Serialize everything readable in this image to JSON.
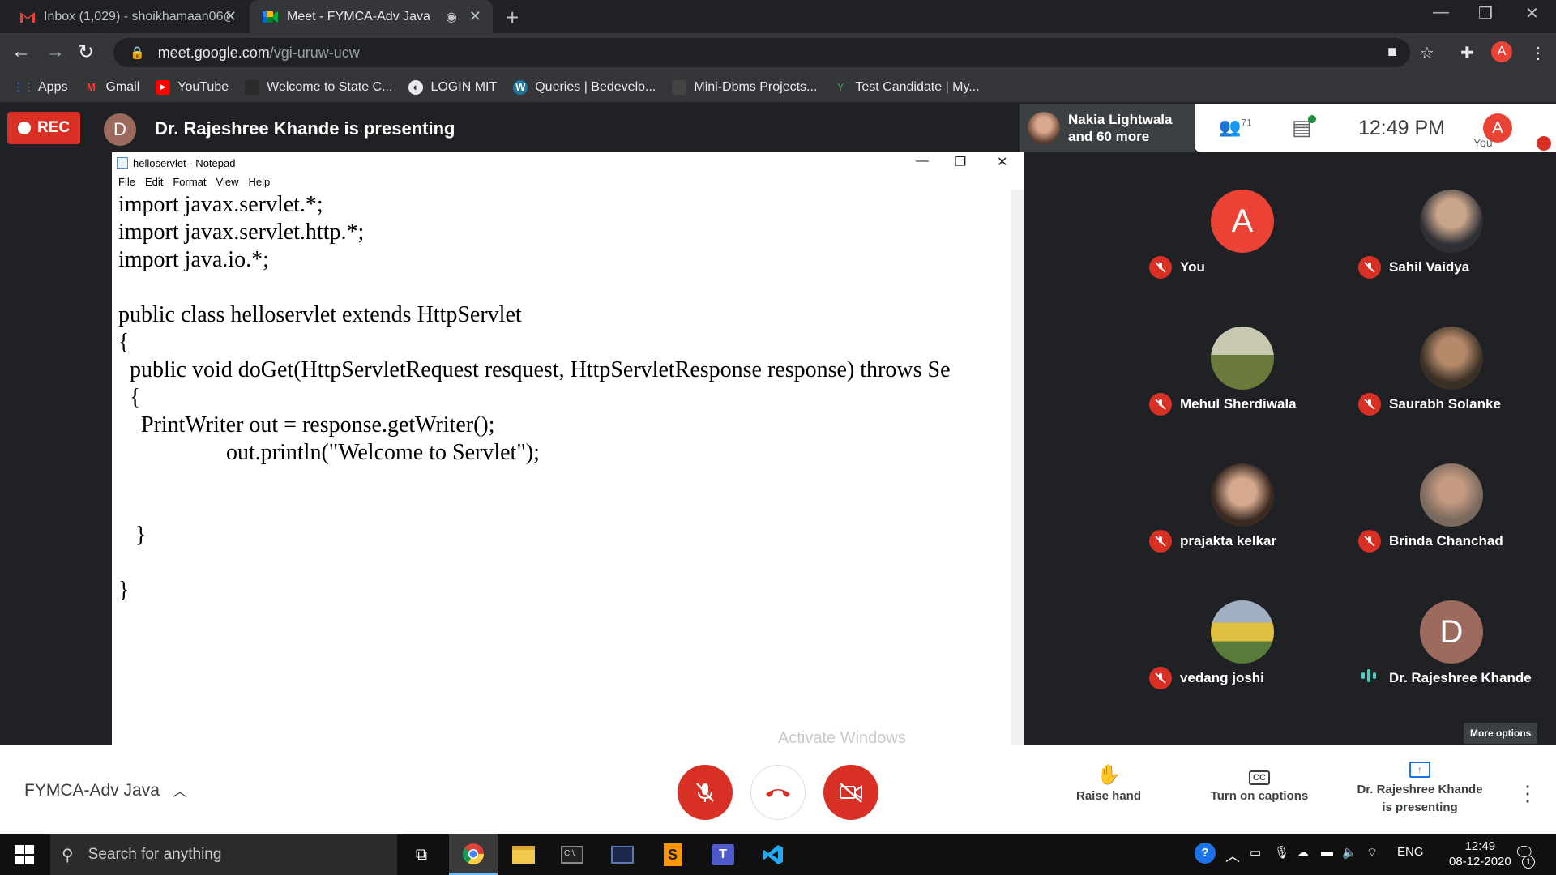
{
  "tabs": [
    {
      "title": "Inbox (1,029) - shoikhamaan06@",
      "favicon": "gmail-icon"
    },
    {
      "title": "Meet - FYMCA-Adv Java",
      "favicon": "meet-icon"
    }
  ],
  "address": {
    "host": "meet.google.com",
    "path": "/vgi-uruw-ucw",
    "profile": "A"
  },
  "bookmarks": [
    "Apps",
    "Gmail",
    "YouTube",
    "Welcome to State C...",
    "LOGIN MIT",
    "Queries | Bedevelo...",
    "Mini-Dbms Projects...",
    "Test Candidate | My..."
  ],
  "meet": {
    "rec_label": "REC",
    "presenter_initial": "D",
    "presenting_title": "Dr. Rajeshree Khande is presenting",
    "featured": {
      "name": "Nakia Lightwala",
      "more": "and 60 more"
    },
    "participant_count": "71",
    "clock": "12:49  PM",
    "you_label": "You",
    "you_initial": "A",
    "meeting_name": "FYMCA-Adv Java",
    "more_options": "More options",
    "controls": {
      "raise_hand": "Raise hand",
      "captions": "Turn on captions",
      "presenting_line1": "Dr. Rajeshree Khande",
      "presenting_line2": "is presenting"
    }
  },
  "notepad": {
    "title": "helloservlet - Notepad",
    "menu": [
      "File",
      "Edit",
      "Format",
      "View",
      "Help"
    ],
    "code": "import javax.servlet.*;\nimport javax.servlet.http.*;\nimport java.io.*;\n\npublic class helloservlet extends HttpServlet\n{\n  public void doGet(HttpServletRequest resquest, HttpServletResponse response) throws Se\n  {\n    PrintWriter out = response.getWriter();\n                   out.println(\"Welcome to Servlet\");\n\n\n   }\n\n}",
    "watermark": "Activate Windows"
  },
  "participants": [
    {
      "name": "You",
      "initial": "A",
      "color": "#ea4335",
      "muted": true
    },
    {
      "name": "Sahil Vaidya",
      "initial": "",
      "color": "#4a4a52",
      "muted": true
    },
    {
      "name": "Mehul Sherdiwala",
      "initial": "",
      "color": "#8a7a4a",
      "muted": true
    },
    {
      "name": "Saurabh Solanke",
      "initial": "",
      "color": "#5a4a3a",
      "muted": true
    },
    {
      "name": "prajakta kelkar",
      "initial": "",
      "color": "#7a5a4a",
      "muted": true
    },
    {
      "name": "Brinda Chanchad",
      "initial": "",
      "color": "#6a5a50",
      "muted": true
    },
    {
      "name": "vedang joshi",
      "initial": "",
      "color": "#6a8a4a",
      "muted": true
    },
    {
      "name": "Dr. Rajeshree Khande",
      "initial": "D",
      "color": "#9c6b5e",
      "muted": false
    }
  ],
  "taskbar": {
    "search_placeholder": "Search for anything",
    "lang": "ENG",
    "time": "12:49",
    "date": "08-12-2020",
    "notifications": "1"
  }
}
